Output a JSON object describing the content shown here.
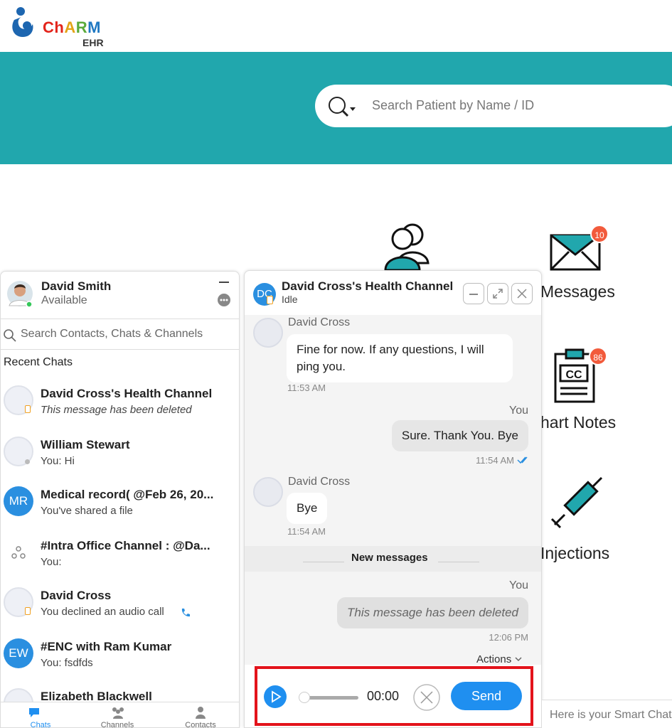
{
  "brand": {
    "name": "ChARM",
    "sub": "EHR",
    "colors": {
      "teal": "#21a7ad",
      "accent": "#1f8ff0",
      "badge": "#f25b3c"
    }
  },
  "header": {
    "search_placeholder": "Search Patient by Name / ID"
  },
  "dashboard": {
    "tiles": [
      {
        "label": "Messages",
        "icon": "envelope-icon",
        "badge": "10"
      },
      {
        "label": "hart Notes",
        "icon": "clipboard-icon",
        "badge": "86"
      },
      {
        "label": "Injections",
        "icon": "syringe-icon"
      }
    ]
  },
  "contacts_panel": {
    "user": {
      "name": "David Smith",
      "status": "Available"
    },
    "search_placeholder": "Search Contacts, Chats & Channels",
    "recent_label": "Recent Chats",
    "items": [
      {
        "title": "David Cross's Health Channel",
        "sub": "This message has been deleted",
        "avatar": ""
      },
      {
        "title": "William Stewart",
        "sub": "You: Hi",
        "avatar": ""
      },
      {
        "title": "Medical record( @Feb 26, 20...",
        "sub": "You've shared a file",
        "avatar": "MR"
      },
      {
        "title": "#Intra Office Channel : @Da...",
        "sub": "You:",
        "avatar": ""
      },
      {
        "title": "David Cross",
        "sub": "You declined an audio call",
        "avatar": ""
      },
      {
        "title": "#ENC with Ram Kumar",
        "sub": "You: fsdfds",
        "avatar": "EW"
      },
      {
        "title": "Elizabeth Blackwell",
        "sub": "",
        "avatar": ""
      }
    ],
    "nav": [
      {
        "label": "Chats"
      },
      {
        "label": "Channels"
      },
      {
        "label": "Contacts"
      }
    ]
  },
  "chat_window": {
    "title": "David Cross's Health Channel",
    "status": "Idle",
    "avatar": "DC",
    "messages": {
      "m1": {
        "sender": "David Cross",
        "text": "Fine for now. If any questions, I will ping you.",
        "time": "11:53 AM"
      },
      "m2": {
        "sender": "You",
        "text": "Sure.  Thank You. Bye",
        "time": "11:54 AM"
      },
      "m3": {
        "sender": "David Cross",
        "text": "Bye",
        "time": "11:54 AM"
      },
      "divider": "New messages",
      "m4": {
        "sender": "You",
        "text": "This message has been deleted",
        "time": "12:06 PM"
      }
    },
    "actions_label": "Actions",
    "recorder": {
      "time": "00:00",
      "send_label": "Send",
      "progress": 0
    }
  },
  "smart_chat": {
    "placeholder": "Here is your Smart Chat"
  }
}
